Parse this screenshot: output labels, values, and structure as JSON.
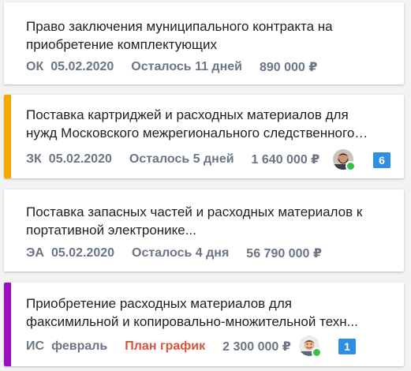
{
  "tenders": [
    {
      "title": "Право заключения муниципального контракта на приобретение комплектующих",
      "type": "ОК",
      "date": "05.02.2020",
      "deadline": "Осталось 11 дней",
      "price": "890 000 ₽",
      "accent_color": "",
      "has_avatar": false,
      "badge": ""
    },
    {
      "title": "Поставка картриджей и расходных материалов для нужд Московского межрегионального следственного…",
      "type": "ЗК",
      "date": "05.02.2020",
      "deadline": "Осталось 5 дней",
      "price": "1 640 000 ₽",
      "accent_color": "#f6a800",
      "has_avatar": true,
      "avatar_online": true,
      "badge": "6"
    },
    {
      "title": "Поставка запасных частей и расходных материалов к портативной электронике...",
      "type": "ЭА",
      "date": "05.02.2020",
      "deadline": "Осталось 4 дня",
      "price": "56 790 000 ₽",
      "accent_color": "",
      "has_avatar": false,
      "badge": ""
    },
    {
      "title": "Приобретение расходных материалов для факсимильной и копировально-множительной техн...",
      "type": "ИС",
      "date": "февраль",
      "deadline": "План график",
      "price": "2 300 000 ₽",
      "accent_color": "#9b0ec0",
      "has_avatar": true,
      "avatar_online": true,
      "badge": "1"
    }
  ],
  "colors": {
    "meta_text": "#6a7686",
    "plan_text": "#d9533d",
    "badge_bg": "#2e8ee6",
    "online": "#35c24a"
  }
}
